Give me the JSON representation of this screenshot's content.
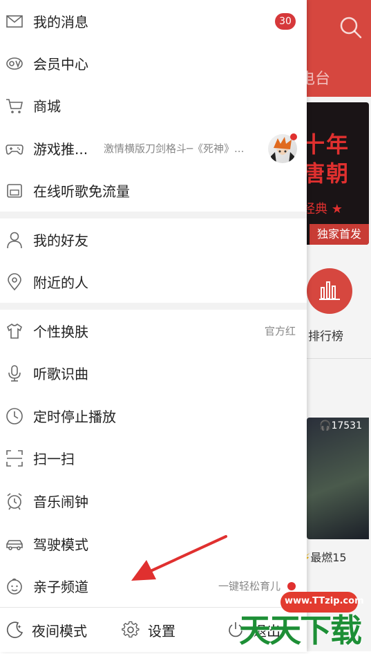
{
  "drawer": {
    "items": [
      {
        "label": "我的消息",
        "icon": "mail-icon",
        "badge": "30"
      },
      {
        "label": "会员中心",
        "icon": "vip-icon"
      },
      {
        "label": "商城",
        "icon": "cart-icon"
      },
      {
        "label": "游戏推...",
        "icon": "gamepad-icon",
        "subtitle": "激情横版刀剑格斗─《死神》..."
      },
      {
        "label": "在线听歌免流量",
        "icon": "sim-card-icon"
      },
      {
        "label": "我的好友",
        "icon": "person-icon"
      },
      {
        "label": "附近的人",
        "icon": "location-pin-icon"
      },
      {
        "label": "个性换肤",
        "icon": "tshirt-icon",
        "right": "官方红"
      },
      {
        "label": "听歌识曲",
        "icon": "microphone-icon"
      },
      {
        "label": "定时停止播放",
        "icon": "clock-icon"
      },
      {
        "label": "扫一扫",
        "icon": "scan-icon"
      },
      {
        "label": "音乐闹钟",
        "icon": "alarm-clock-icon"
      },
      {
        "label": "驾驶模式",
        "icon": "car-icon"
      },
      {
        "label": "亲子频道",
        "icon": "baby-face-icon",
        "right": "一键轻松育儿"
      }
    ],
    "bottom": {
      "night_mode": "夜间模式",
      "settings": "设置",
      "exit": "退出"
    }
  },
  "background": {
    "tab_text": "电台",
    "banner_big": "十年\n唐朝",
    "banner_small": "经典 ★",
    "banner_tag": "独家首发",
    "rank_label": "排行榜",
    "card_count": "17531",
    "card_title": "最燃15",
    "watermark_url": "www.TTzip.com",
    "watermark_text": "天天下载"
  },
  "colors": {
    "accent": "#d6473f",
    "badge": "#d6383a",
    "arrow": "#e0302f"
  }
}
